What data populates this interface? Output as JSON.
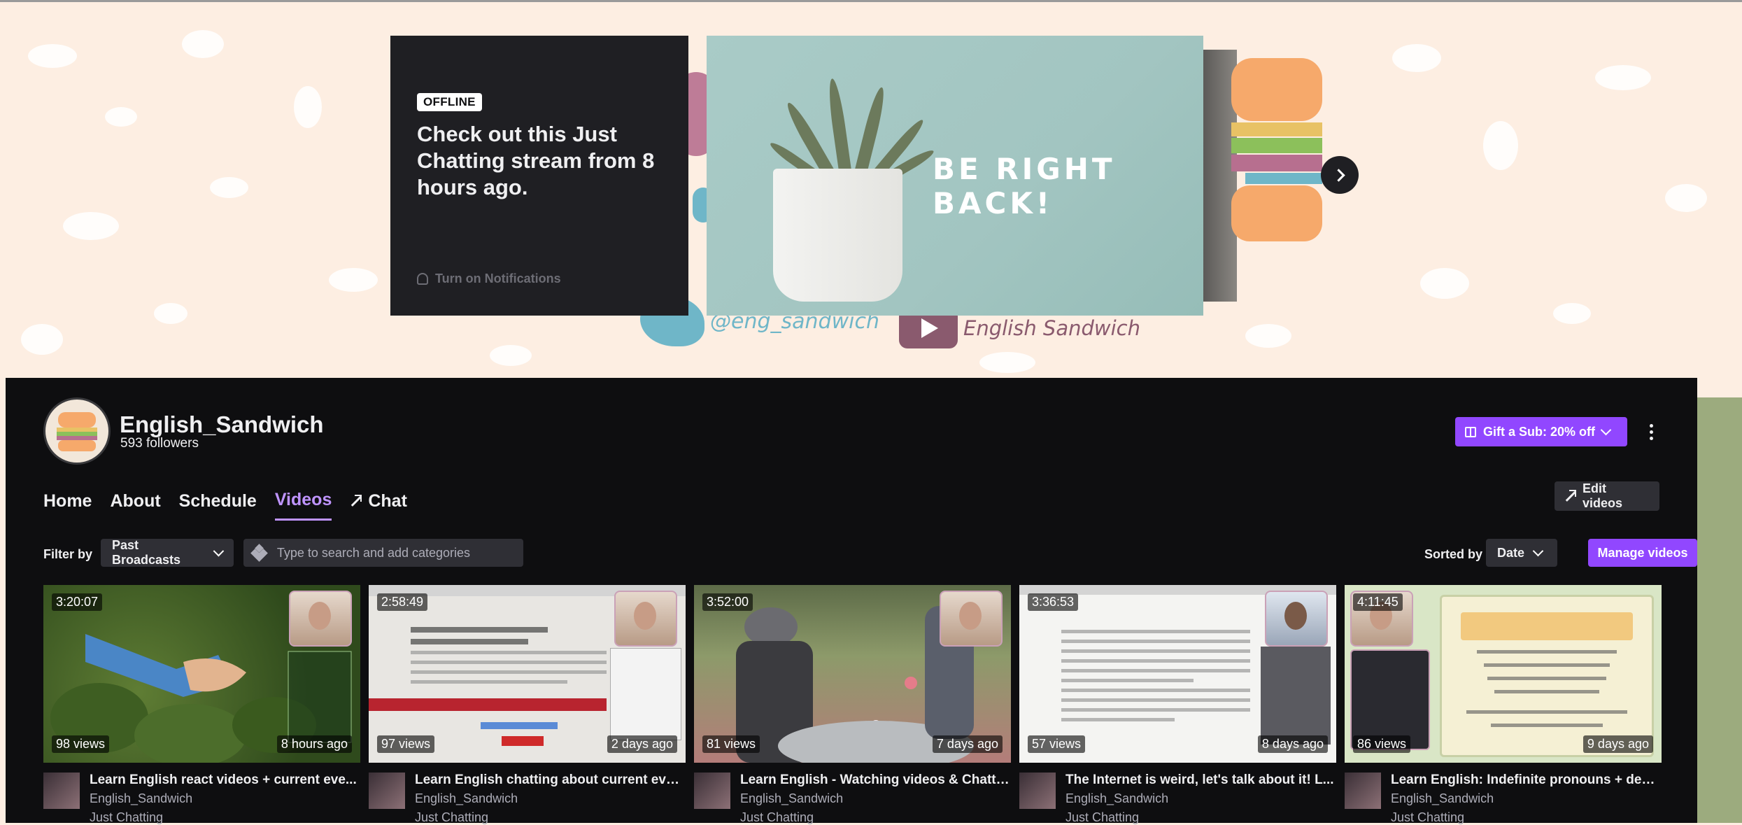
{
  "banner": {
    "offline_badge": "OFFLINE",
    "offline_title": "Check out this Just Chatting stream from 8 hours ago.",
    "notifications_label": "Turn on Notifications",
    "brb_text": "BE RIGHT BACK!",
    "twitter_handle": "@eng_sandwich",
    "youtube_name": "English Sandwich"
  },
  "channel": {
    "name": "English_Sandwich",
    "followers": "593 followers",
    "gift_label": "Gift a Sub: 20% off"
  },
  "tabs": [
    {
      "label": "Home"
    },
    {
      "label": "About"
    },
    {
      "label": "Schedule"
    },
    {
      "label": "Videos"
    },
    {
      "label": "Chat"
    }
  ],
  "edit_videos_label": "Edit videos",
  "filter": {
    "label": "Filter by",
    "selected": "Past Broadcasts",
    "search_placeholder": "Type to search and add categories",
    "sorted_label": "Sorted by",
    "sort_selected": "Date",
    "manage_label": "Manage videos"
  },
  "videos": [
    {
      "duration": "3:20:07",
      "views": "98 views",
      "age": "8 hours ago",
      "title": "Learn English react videos + current eve...",
      "channel": "English_Sandwich",
      "category": "Just Chatting"
    },
    {
      "duration": "2:58:49",
      "views": "97 views",
      "age": "2 days ago",
      "title": "Learn English chatting about current eve...",
      "channel": "English_Sandwich",
      "category": "Just Chatting"
    },
    {
      "duration": "3:52:00",
      "views": "81 views",
      "age": "7 days ago",
      "title": "Learn English - Watching videos & Chatti...",
      "channel": "English_Sandwich",
      "category": "Just Chatting"
    },
    {
      "duration": "3:36:53",
      "views": "57 views",
      "age": "8 days ago",
      "title": "The Internet is weird, let's talk about it! L...",
      "channel": "English_Sandwich",
      "category": "Just Chatting"
    },
    {
      "duration": "4:11:45",
      "views": "86 views",
      "age": "9 days ago",
      "title": "Learn English: Indefinite pronouns + deb...",
      "channel": "English_Sandwich",
      "category": "Just Chatting"
    }
  ],
  "colors": {
    "accent": "#9147ff",
    "accent_text": "#bf94ff",
    "panel_bg": "#0e0e10",
    "banner_bg": "#fdeee2"
  },
  "icons": [
    "bell-icon",
    "chevron-right-icon",
    "gift-icon",
    "chevron-down-icon",
    "more-vertical-icon",
    "external-link-icon",
    "category-icon"
  ]
}
